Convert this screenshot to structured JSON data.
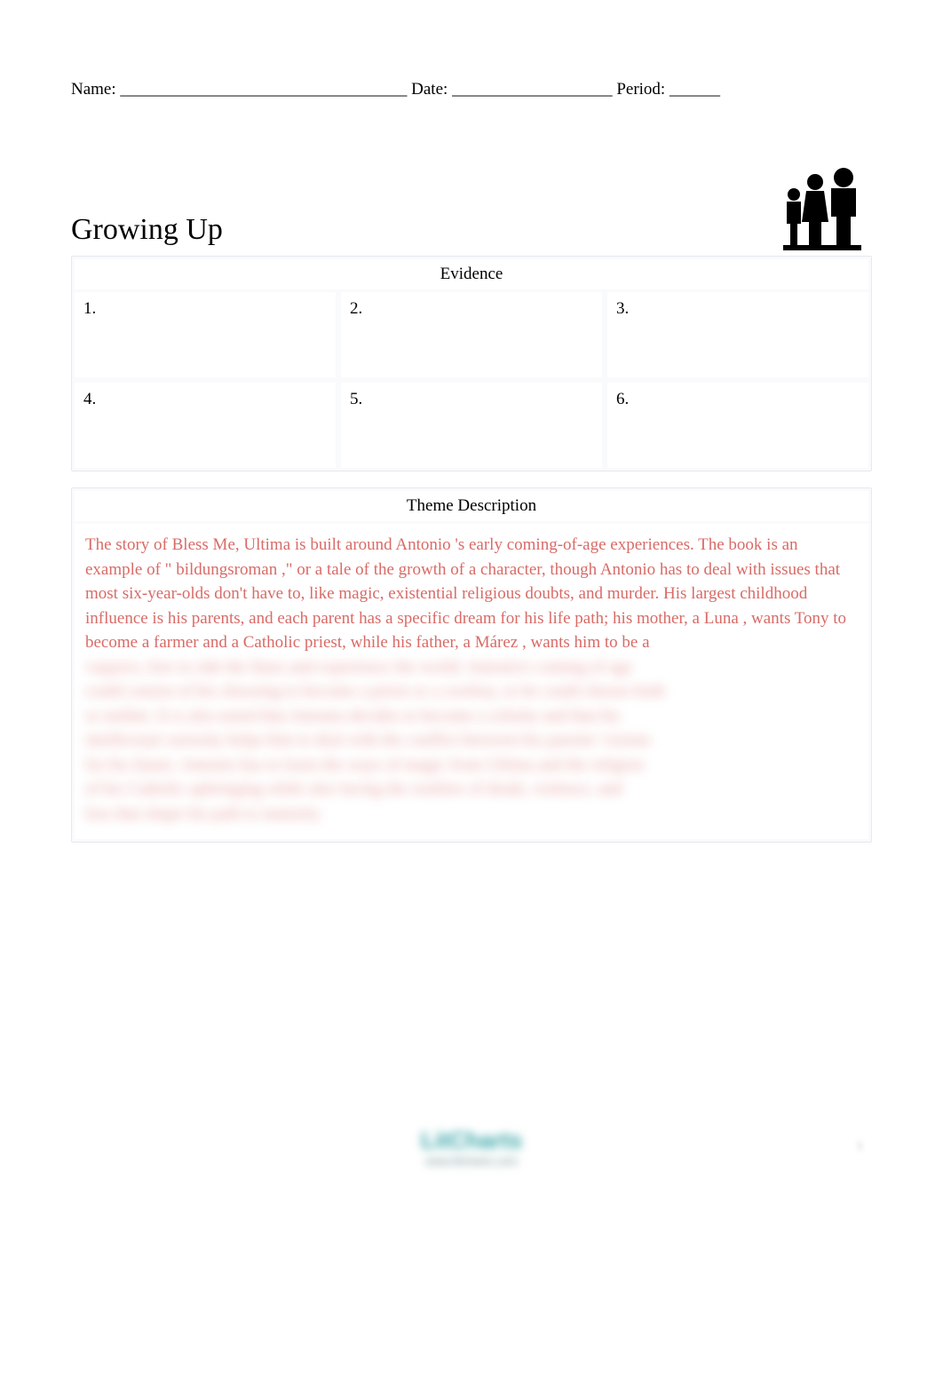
{
  "header": {
    "name_label": "Name:",
    "name_blank": "__________________________________",
    "date_label": "Date:",
    "date_blank": "___________________",
    "period_label": "Period:",
    "period_blank": "______"
  },
  "title": "Growing Up",
  "icon": "family-silhouette",
  "evidence": {
    "header": "Evidence",
    "cells": [
      "1.",
      "2.",
      "3.",
      "4.",
      "5.",
      "6."
    ]
  },
  "theme": {
    "header": "Theme Description",
    "visible_text": {
      "part1": "The story of ",
      "link1": "Bless Me, Ultima",
      "part2": " is built around ",
      "link2": "Antonio",
      "part3": "'s early coming-of-age experiences. The book is an example of \"",
      "link3": "bildungsroman",
      "part4": ",\" or a tale of the growth of a character, though Antonio has to deal with issues that most six-year-olds don't have to, like magic, existential religious doubts, and murder. His largest childhood influence is his parents, and each parent has a specific dream for his life path; his mother, a ",
      "link4": "Luna",
      "part5": ", wants Tony to become a farmer and a Catholic priest, while his father, a ",
      "link5": "Márez",
      "part6": ", wants him to be a"
    },
    "blurred_lines": [
      "vaquero, free to ride the llano and experience the world. Antonio's coming of age",
      "could consist of his choosing to become a priest or a cowboy, or he could choose both",
      "or neither. It is also noted that Antonio decides to become a scholar and that his",
      "intellectual curiosity helps him to deal with the conflict between his parents' visions",
      "for his future. Antonio has to learn the ways of magic from Ultima and the religion",
      "of his Catholic upbringing while also facing the realities of death, violence, and",
      "loss that shape his path to maturity."
    ]
  },
  "footer": {
    "logo_main": "LitCharts",
    "logo_sub": "www.litcharts.com",
    "page": "1"
  }
}
